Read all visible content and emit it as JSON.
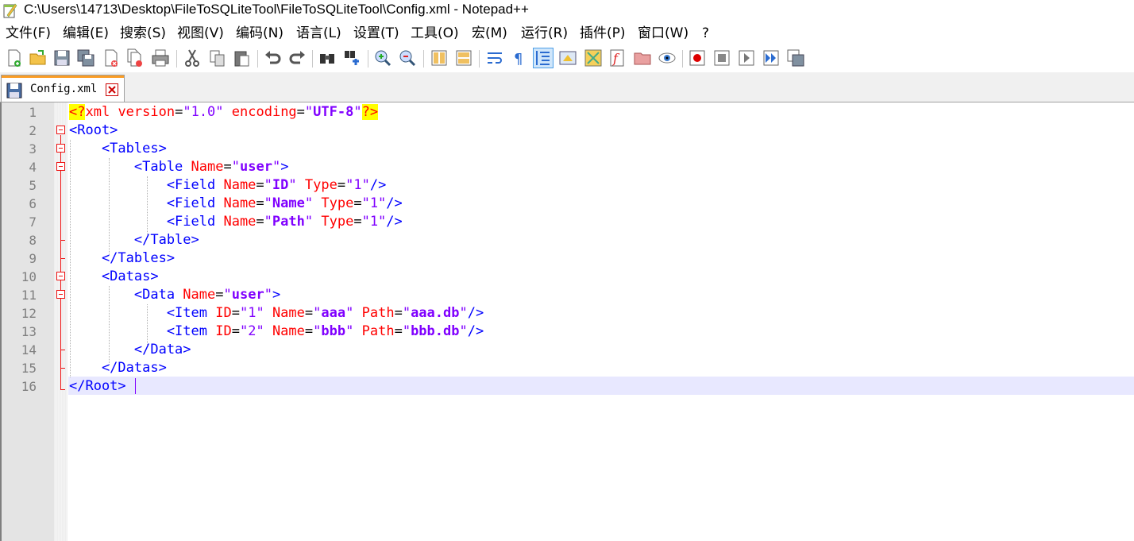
{
  "window": {
    "title": "C:\\Users\\14713\\Desktop\\FileToSQLiteTool\\FileToSQLiteTool\\Config.xml - Notepad++"
  },
  "menu": [
    "文件(F)",
    "编辑(E)",
    "搜索(S)",
    "视图(V)",
    "编码(N)",
    "语言(L)",
    "设置(T)",
    "工具(O)",
    "宏(M)",
    "运行(R)",
    "插件(P)",
    "窗口(W)",
    "?"
  ],
  "toolbar": {
    "icons": [
      "new-file-icon",
      "open-file-icon",
      "save-icon",
      "save-all-icon",
      "close-icon",
      "close-all-icon",
      "print-icon",
      "cut-icon",
      "copy-icon",
      "paste-icon",
      "undo-icon",
      "redo-icon",
      "find-icon",
      "replace-icon",
      "zoom-in-icon",
      "zoom-out-icon",
      "sync-vertical-icon",
      "sync-horizontal-icon",
      "word-wrap-icon",
      "show-all-chars-icon",
      "indent-guide-icon",
      "user-language-icon",
      "document-map-icon",
      "function-list-icon",
      "folder-as-workspace-icon",
      "monitoring-icon",
      "record-macro-icon",
      "stop-recording-icon",
      "play-macro-icon",
      "run-macro-multiple-icon",
      "save-macro-icon"
    ]
  },
  "tab": {
    "label": "Config.xml"
  },
  "editor": {
    "line_numbers": [
      "1",
      "2",
      "3",
      "4",
      "5",
      "6",
      "7",
      "8",
      "9",
      "10",
      "11",
      "12",
      "13",
      "14",
      "15",
      "16"
    ],
    "current_line": 16,
    "lines": [
      [
        [
          "decl",
          "<?"
        ],
        [
          "xml",
          "xml "
        ],
        [
          "attr",
          "version"
        ],
        [
          "eq",
          "="
        ],
        [
          "q",
          "\"1.0\""
        ],
        [
          "xml",
          " "
        ],
        [
          "attr",
          "encoding"
        ],
        [
          "eq",
          "="
        ],
        [
          "q",
          "\""
        ],
        [
          "val",
          "UTF-8"
        ],
        [
          "q",
          "\""
        ],
        [
          "decl",
          "?>"
        ]
      ],
      [
        [
          "tag",
          "<Root>"
        ]
      ],
      [
        [
          "tag",
          "    <Tables>"
        ]
      ],
      [
        [
          "tag",
          "        <Table "
        ],
        [
          "attr",
          "Name"
        ],
        [
          "eq",
          "="
        ],
        [
          "q",
          "\""
        ],
        [
          "val",
          "user"
        ],
        [
          "q",
          "\""
        ],
        [
          "tag",
          ">"
        ]
      ],
      [
        [
          "tag",
          "            <Field "
        ],
        [
          "attr",
          "Name"
        ],
        [
          "eq",
          "="
        ],
        [
          "q",
          "\""
        ],
        [
          "val",
          "ID"
        ],
        [
          "q",
          "\""
        ],
        [
          "tag",
          " "
        ],
        [
          "attr",
          "Type"
        ],
        [
          "eq",
          "="
        ],
        [
          "q",
          "\"1\""
        ],
        [
          "tag",
          "/>"
        ]
      ],
      [
        [
          "tag",
          "            <Field "
        ],
        [
          "attr",
          "Name"
        ],
        [
          "eq",
          "="
        ],
        [
          "q",
          "\""
        ],
        [
          "val",
          "Name"
        ],
        [
          "q",
          "\""
        ],
        [
          "tag",
          " "
        ],
        [
          "attr",
          "Type"
        ],
        [
          "eq",
          "="
        ],
        [
          "q",
          "\"1\""
        ],
        [
          "tag",
          "/>"
        ]
      ],
      [
        [
          "tag",
          "            <Field "
        ],
        [
          "attr",
          "Name"
        ],
        [
          "eq",
          "="
        ],
        [
          "q",
          "\""
        ],
        [
          "val",
          "Path"
        ],
        [
          "q",
          "\""
        ],
        [
          "tag",
          " "
        ],
        [
          "attr",
          "Type"
        ],
        [
          "eq",
          "="
        ],
        [
          "q",
          "\"1\""
        ],
        [
          "tag",
          "/>"
        ]
      ],
      [
        [
          "tag",
          "        </Table>"
        ]
      ],
      [
        [
          "tag",
          "    </Tables>"
        ]
      ],
      [
        [
          "tag",
          "    <Datas>"
        ]
      ],
      [
        [
          "tag",
          "        <Data "
        ],
        [
          "attr",
          "Name"
        ],
        [
          "eq",
          "="
        ],
        [
          "q",
          "\""
        ],
        [
          "val",
          "user"
        ],
        [
          "q",
          "\""
        ],
        [
          "tag",
          ">"
        ]
      ],
      [
        [
          "tag",
          "            <Item "
        ],
        [
          "attr",
          "ID"
        ],
        [
          "eq",
          "="
        ],
        [
          "q",
          "\"1\""
        ],
        [
          "tag",
          " "
        ],
        [
          "attr",
          "Name"
        ],
        [
          "eq",
          "="
        ],
        [
          "q",
          "\""
        ],
        [
          "val",
          "aaa"
        ],
        [
          "q",
          "\""
        ],
        [
          "tag",
          " "
        ],
        [
          "attr",
          "Path"
        ],
        [
          "eq",
          "="
        ],
        [
          "q",
          "\""
        ],
        [
          "val",
          "aaa.db"
        ],
        [
          "q",
          "\""
        ],
        [
          "tag",
          "/>"
        ]
      ],
      [
        [
          "tag",
          "            <Item "
        ],
        [
          "attr",
          "ID"
        ],
        [
          "eq",
          "="
        ],
        [
          "q",
          "\"2\""
        ],
        [
          "tag",
          " "
        ],
        [
          "attr",
          "Name"
        ],
        [
          "eq",
          "="
        ],
        [
          "q",
          "\""
        ],
        [
          "val",
          "bbb"
        ],
        [
          "q",
          "\""
        ],
        [
          "tag",
          " "
        ],
        [
          "attr",
          "Path"
        ],
        [
          "eq",
          "="
        ],
        [
          "q",
          "\""
        ],
        [
          "val",
          "bbb.db"
        ],
        [
          "q",
          "\""
        ],
        [
          "tag",
          "/>"
        ]
      ],
      [
        [
          "tag",
          "        </Data>"
        ]
      ],
      [
        [
          "tag",
          "    </Datas>"
        ]
      ],
      [
        [
          "tag",
          "</Root>"
        ]
      ]
    ]
  }
}
